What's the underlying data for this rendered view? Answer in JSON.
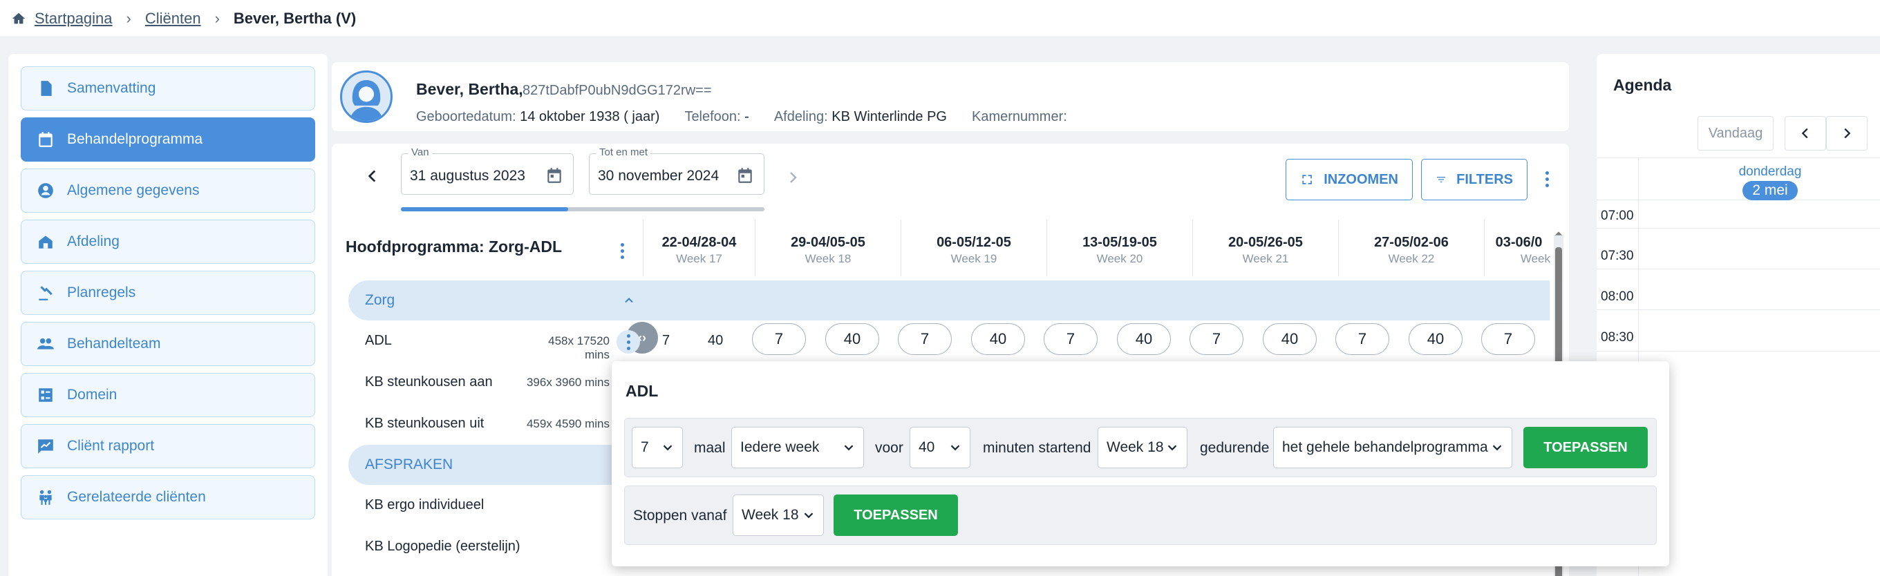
{
  "breadcrumb": {
    "home": "Startpagina",
    "clients": "Cliënten",
    "current": "Bever, Bertha (V)"
  },
  "sidebar": {
    "items": [
      {
        "label": "Samenvatting",
        "icon": "summary-icon"
      },
      {
        "label": "Behandelprogramma",
        "icon": "calendar-icon",
        "active": true
      },
      {
        "label": "Algemene gegevens",
        "icon": "person-icon"
      },
      {
        "label": "Afdeling",
        "icon": "building-icon"
      },
      {
        "label": "Planregels",
        "icon": "gavel-icon"
      },
      {
        "label": "Behandelteam",
        "icon": "team-icon"
      },
      {
        "label": "Domein",
        "icon": "domain-icon"
      },
      {
        "label": "Cliënt rapport",
        "icon": "report-icon"
      },
      {
        "label": "Gerelateerde cliënten",
        "icon": "related-clients-icon"
      }
    ]
  },
  "patient": {
    "name": "Bever, Bertha,",
    "id": "827tDabfP0ubN9dGG172rw==",
    "birth_label": "Geboortedatum:",
    "birth_value": "14 oktober 1938 ( jaar)",
    "phone_label": "Telefoon:",
    "phone_value": "-",
    "dept_label": "Afdeling:",
    "dept_value": "KB Winterlinde PG",
    "room_label": "Kamernummer:",
    "room_value": ""
  },
  "filters": {
    "from_label": "Van",
    "from_value": "31 augustus 2023",
    "to_label": "Tot en met",
    "to_value": "30 november 2024",
    "progress": 0.46,
    "zoom_label": "INZOOMEN",
    "filters_label": "FILTERS"
  },
  "grid": {
    "title": "Hoofdprogramma: Zorg-ADL",
    "weeks": [
      {
        "dates": "22-04/28-04",
        "week": "Week 17"
      },
      {
        "dates": "29-04/05-05",
        "week": "Week 18"
      },
      {
        "dates": "06-05/12-05",
        "week": "Week 19"
      },
      {
        "dates": "13-05/19-05",
        "week": "Week 20"
      },
      {
        "dates": "20-05/26-05",
        "week": "Week 21"
      },
      {
        "dates": "27-05/02-06",
        "week": "Week 22"
      },
      {
        "dates": "03-06/0",
        "week": "Week"
      }
    ],
    "group_zorg": "Zorg",
    "group_afspraken": "AFSPRAKEN",
    "rows": [
      {
        "label": "ADL",
        "mins": "458x 17520 mins"
      },
      {
        "label": "KB steunkousen aan",
        "mins": "396x 3960 mins"
      },
      {
        "label": "KB steunkousen uit",
        "mins": "459x 4590 mins"
      },
      {
        "label": "KB ergo individueel",
        "mins": ""
      },
      {
        "label": "KB Logopedie (eerstelijn)",
        "mins": ""
      }
    ],
    "adl_week17": [
      "7",
      "40"
    ],
    "adl_pills": [
      "7",
      "40",
      "7",
      "40",
      "7",
      "40",
      "7",
      "40",
      "7",
      "40",
      "7"
    ]
  },
  "popup": {
    "title": "ADL",
    "times": "7",
    "maal": "maal",
    "frequency": "Iedere week",
    "voor": "voor",
    "minutes": "40",
    "minuten_startend": "minuten startend",
    "start_week": "Week 18",
    "gedurende": "gedurende",
    "duration": "het gehele behandelprogramma",
    "apply": "TOEPASSEN",
    "stop_label": "Stoppen vanaf",
    "stop_week": "Week 18",
    "apply2": "TOEPASSEN"
  },
  "agenda": {
    "title": "Agenda",
    "today": "Vandaag",
    "day_name": "donderdag",
    "day_date": "2 mei",
    "times": [
      "07:00",
      "07:30",
      "08:00",
      "08:30"
    ]
  },
  "colors": {
    "primary": "#4a8fdc",
    "green": "#1fa84f",
    "group_bg": "#dbe9f7"
  }
}
